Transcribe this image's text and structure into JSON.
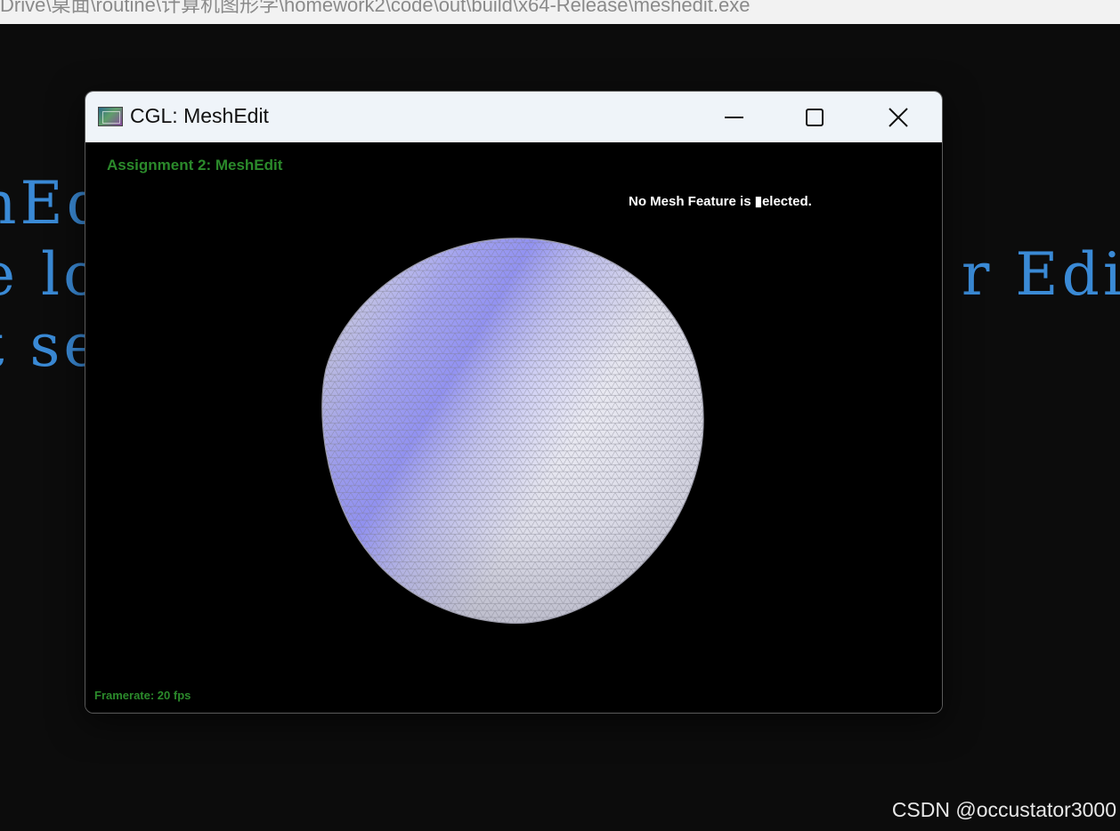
{
  "background": {
    "path_text": "Drive\\桌面\\routine\\计算机图形学\\homework2\\code\\out\\build\\x64-Release\\meshedit.exe",
    "console_lines": [
      "hEdi",
      "e lo",
      "t se"
    ],
    "console_lines_right": [
      "r Edit"
    ]
  },
  "window": {
    "title": "CGL: MeshEdit",
    "minimize_label": "minimize",
    "maximize_label": "maximize",
    "close_label": "close"
  },
  "viewport": {
    "assignment_title": "Assignment 2: MeshEdit",
    "selection_status": "No Mesh Feature is ▮elected.",
    "framerate": "Framerate: 20 fps"
  },
  "watermark": "CSDN @occustator3000",
  "colors": {
    "hud_green": "#2b8a2b",
    "console_blue": "#3a8ad6",
    "mesh_base": "#e2e2ee",
    "mesh_highlight": "#8e8ef2",
    "titlebar": "#eff4f9"
  }
}
